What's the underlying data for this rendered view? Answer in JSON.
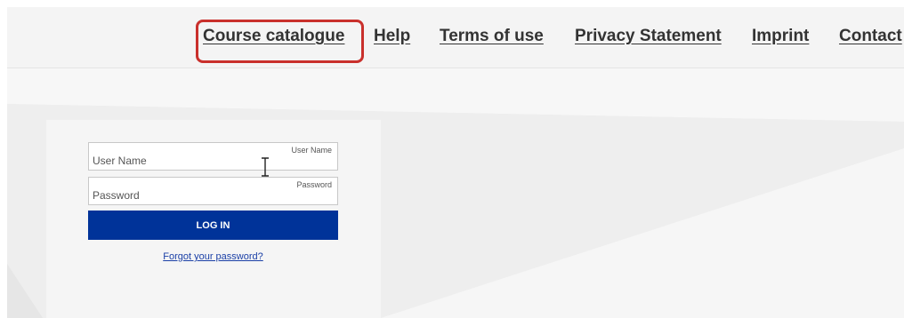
{
  "nav": {
    "items": [
      {
        "label": "Course catalogue"
      },
      {
        "label": "Help"
      },
      {
        "label": "Terms of use"
      },
      {
        "label": "Privacy Statement"
      },
      {
        "label": "Imprint"
      },
      {
        "label": "Contact"
      }
    ],
    "highlighted_item": "Course catalogue",
    "highlight_color": "#c9302c"
  },
  "login": {
    "username": {
      "placeholder": "User Name",
      "label": "User Name",
      "value": ""
    },
    "password": {
      "placeholder": "Password",
      "label": "Password",
      "value": ""
    },
    "submit_label": "LOG IN",
    "forgot_label": "Forgot your password?",
    "button_color": "#003399",
    "link_color": "#1a3fa6"
  },
  "cursor": {
    "icon": "text-cursor-icon"
  }
}
